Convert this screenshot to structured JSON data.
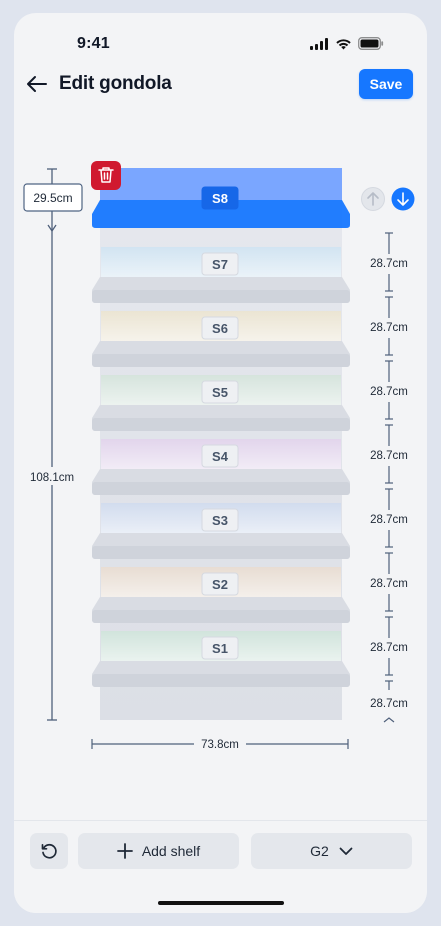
{
  "status_bar": {
    "time": "9:41"
  },
  "header": {
    "title": "Edit gondola",
    "save_label": "Save"
  },
  "gondola": {
    "selected_shelf": "S8",
    "shelves": [
      {
        "label": "S8",
        "selected": true,
        "color": "#7aa6ff"
      },
      {
        "label": "S7",
        "selected": false,
        "color": "#cfe3f2"
      },
      {
        "label": "S6",
        "selected": false,
        "color": "#ece4cf"
      },
      {
        "label": "S5",
        "selected": false,
        "color": "#d3e4da"
      },
      {
        "label": "S4",
        "selected": false,
        "color": "#e2d2ec"
      },
      {
        "label": "S3",
        "selected": false,
        "color": "#cfdaef"
      },
      {
        "label": "S2",
        "selected": false,
        "color": "#eadccf"
      },
      {
        "label": "S1",
        "selected": false,
        "color": "#cfe4d9"
      }
    ],
    "top_gap": "29.5cm",
    "total_height": "108.1cm",
    "total_width": "73.8cm",
    "shelf_gaps": [
      "28.7cm",
      "28.7cm",
      "28.7cm",
      "28.7cm",
      "28.7cm",
      "28.7cm",
      "28.7cm"
    ],
    "base_gap": "28.7cm"
  },
  "bottom_bar": {
    "add_label": "Add shelf",
    "gondola_select": "G2"
  },
  "colors": {
    "accent": "#1677ff",
    "delete": "#d0192f",
    "dimension_line": "#4f607b"
  }
}
